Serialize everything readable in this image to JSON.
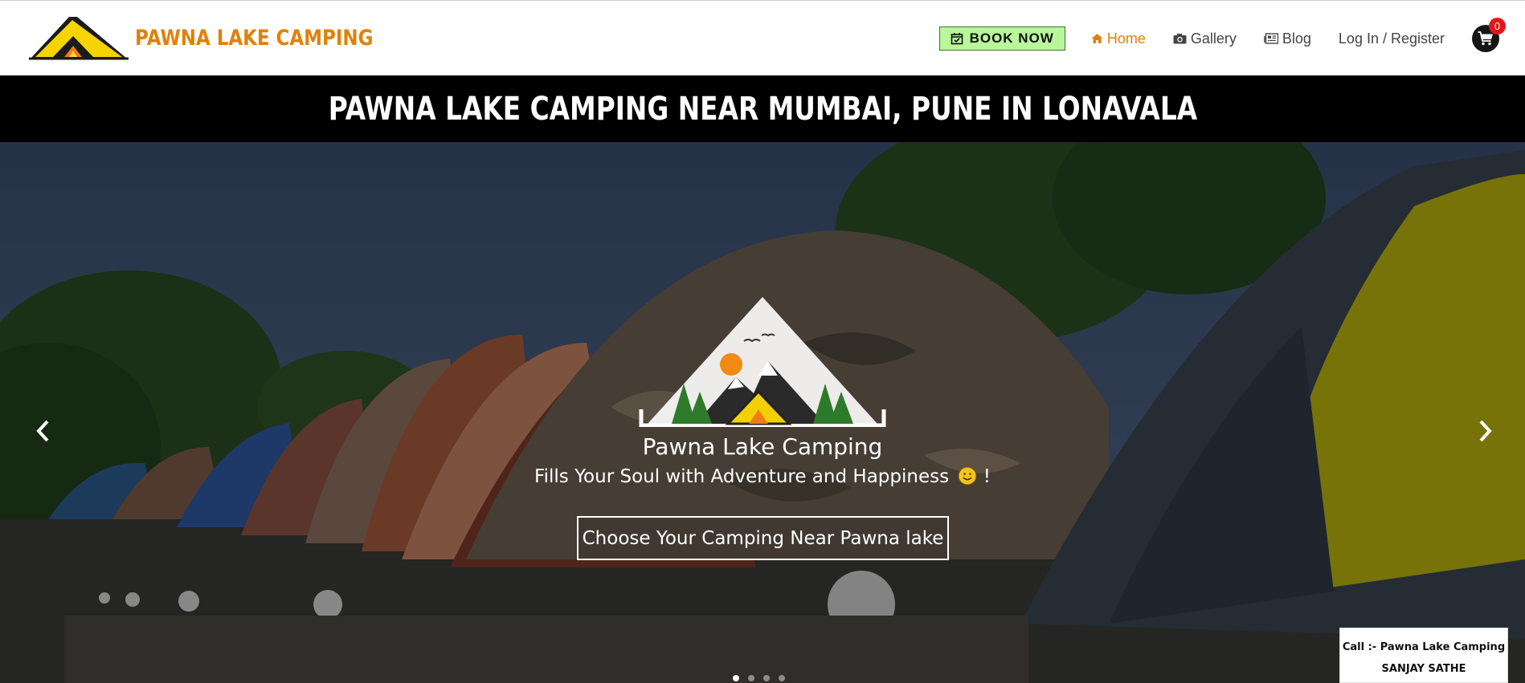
{
  "brand": {
    "name": "PAWNA LAKE CAMPING",
    "logo_icon": "tent-campfire-logo"
  },
  "nav": {
    "book_now": "BOOK NOW",
    "home": "Home",
    "gallery": "Gallery",
    "blog": "Blog",
    "login": "Log In / Register",
    "cart_count": "0"
  },
  "banner": {
    "title": "PAWNA LAKE CAMPING NEAR MUMBAI, PUNE IN LONAVALA"
  },
  "hero": {
    "title": "Pawna Lake Camping",
    "subtitle": "Fills Your Soul with Adventure and Happiness",
    "subtitle_suffix": "!",
    "cta": "Choose Your Camping Near Pawna lake",
    "slides": 4,
    "active_slide": 1
  },
  "call_box": {
    "line1": "Call :- Pawna Lake Camping",
    "line2": "SANJAY SATHE"
  },
  "colors": {
    "accent": "#e0800b",
    "book_bg": "#b8f79a",
    "badge": "#e3141a"
  }
}
